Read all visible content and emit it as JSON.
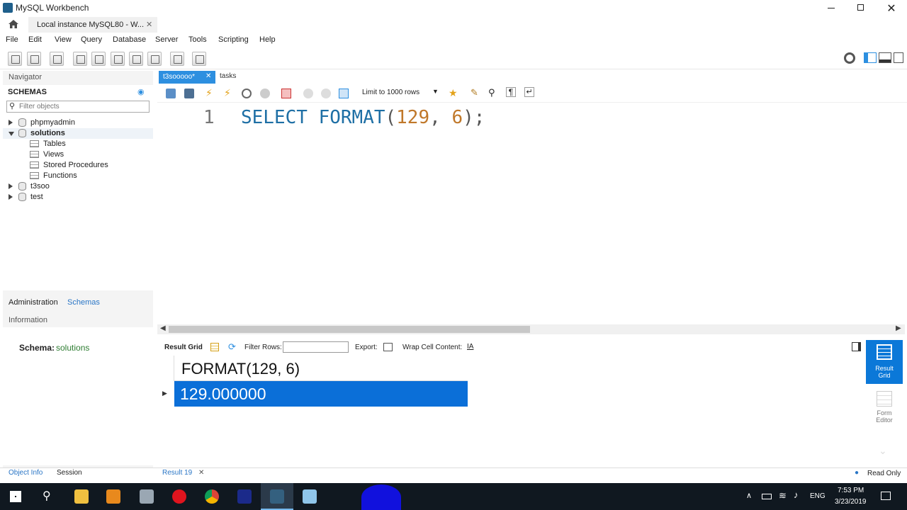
{
  "window": {
    "title": "MySQL Workbench"
  },
  "conn_tab": {
    "label": "Local instance MySQL80 - W..."
  },
  "menu": [
    "File",
    "Edit",
    "View",
    "Query",
    "Database",
    "Server",
    "Tools",
    "Scripting",
    "Help"
  ],
  "navigator": {
    "header": "Navigator",
    "schemas_label": "SCHEMAS",
    "filter_placeholder": "Filter objects",
    "tree": [
      {
        "label": "phpmyadmin",
        "type": "db",
        "expanded": false,
        "bold": false
      },
      {
        "label": "solutions",
        "type": "db",
        "expanded": true,
        "bold": true
      },
      {
        "label": "Tables",
        "type": "folder"
      },
      {
        "label": "Views",
        "type": "folder"
      },
      {
        "label": "Stored Procedures",
        "type": "folder"
      },
      {
        "label": "Functions",
        "type": "folder"
      },
      {
        "label": "t3soo",
        "type": "db",
        "expanded": false,
        "bold": false
      },
      {
        "label": "test",
        "type": "db",
        "expanded": false,
        "bold": false
      }
    ],
    "tabs": {
      "admin": "Administration",
      "schemas": "Schemas"
    },
    "info_header": "Information",
    "schema_info_label": "Schema:",
    "schema_info_value": "solutions",
    "bottom_tabs": {
      "object_info": "Object Info",
      "session": "Session"
    }
  },
  "editor_tabs": [
    {
      "label": "t3sooooo*",
      "active": true
    },
    {
      "label": "tasks",
      "active": false
    }
  ],
  "editor_toolbar": {
    "limit_label": "Limit to 1000 rows"
  },
  "editor": {
    "line_number": "1",
    "code": {
      "kw1": "SELECT",
      "fn": "FORMAT",
      "open": "(",
      "n1": "129",
      "comma": ", ",
      "n2": "6",
      "close": ");"
    }
  },
  "result_toolbar": {
    "result_grid": "Result Grid",
    "filter_rows": "Filter Rows:",
    "export": "Export:",
    "wrap": "Wrap Cell Content:"
  },
  "result": {
    "column": "FORMAT(129, 6)",
    "value": "129.000000"
  },
  "right_panel": {
    "result_grid_line1": "Result",
    "result_grid_line2": "Grid",
    "form_editor_line1": "Form",
    "form_editor_line2": "Editor"
  },
  "status": {
    "result_tab": "Result 19",
    "read_only": "Read Only"
  },
  "taskbar": {
    "lang": "ENG",
    "time": "7:53 PM",
    "date": "3/23/2019"
  },
  "colors": {
    "accent": "#2d8fe0",
    "selection": "#0b6fd8",
    "keyword": "#1e6fa5",
    "number": "#c0782a",
    "link": "#2a76c6"
  }
}
